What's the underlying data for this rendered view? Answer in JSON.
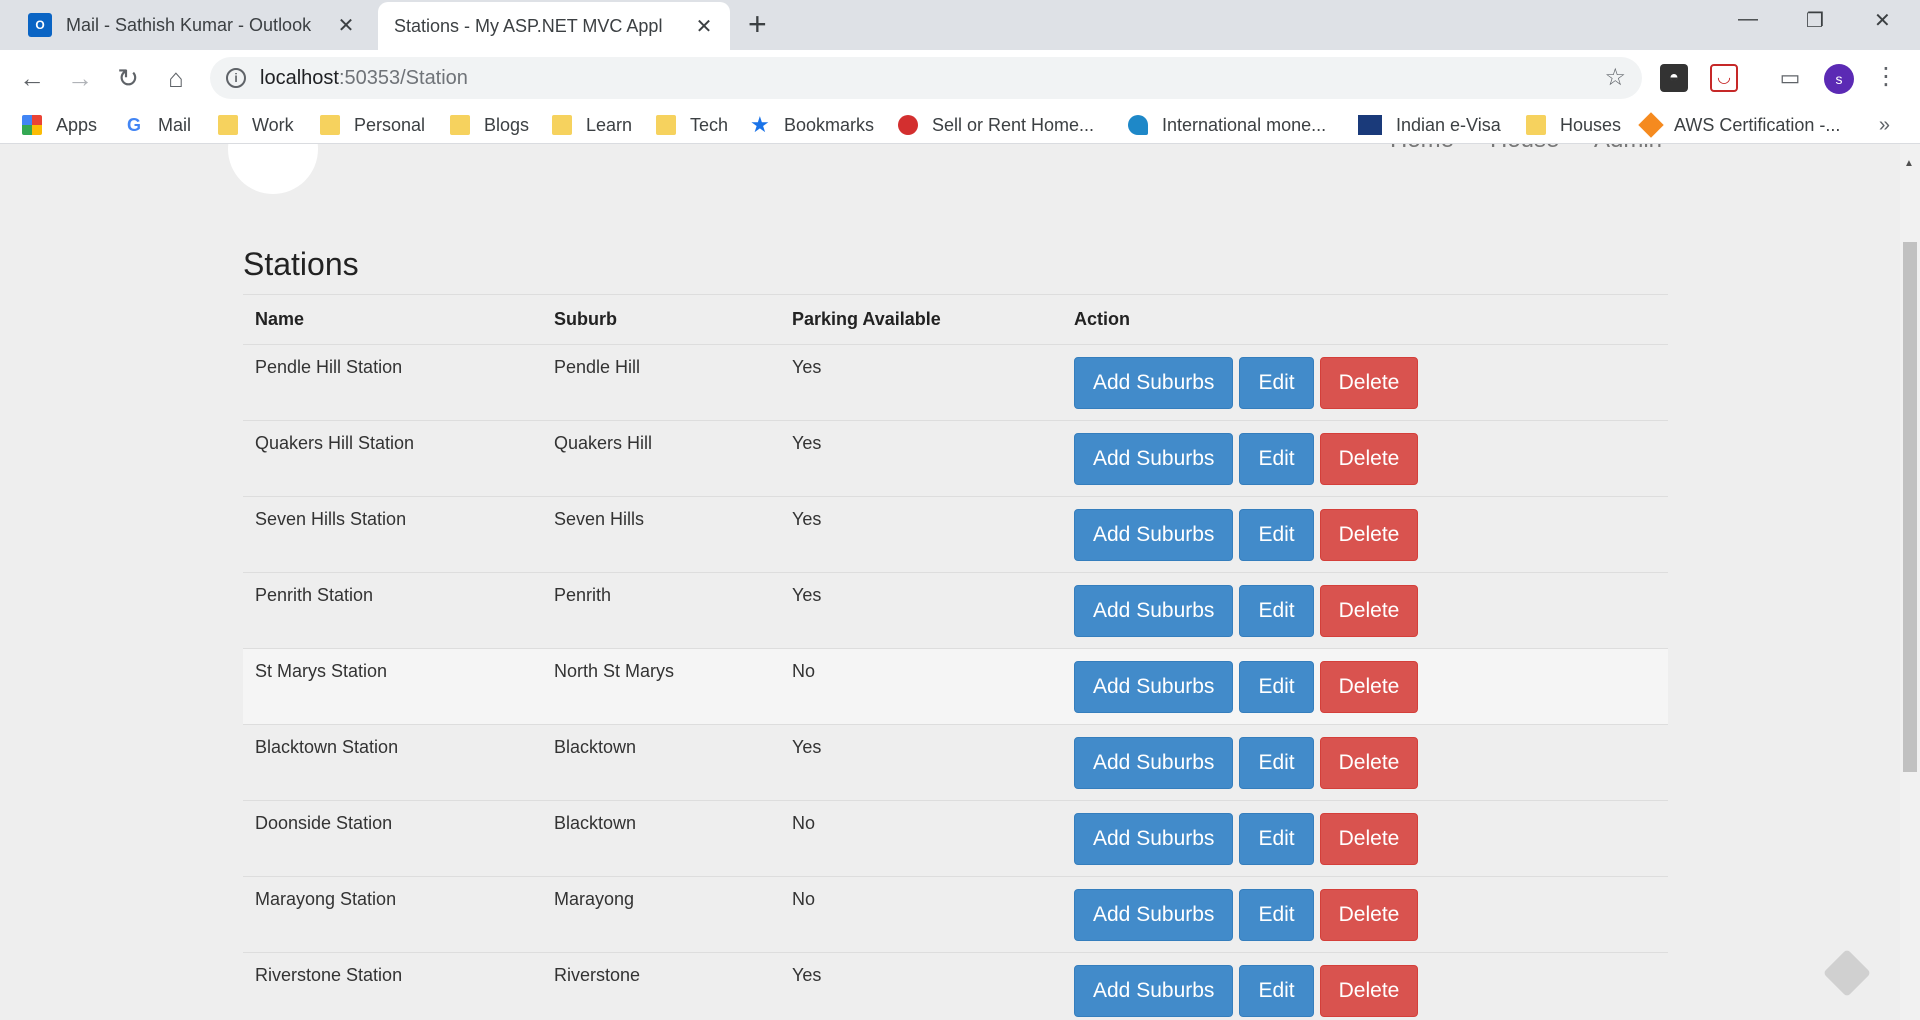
{
  "tabs": [
    {
      "title": "Mail - Sathish Kumar - Outlook",
      "close": "✕"
    },
    {
      "title": "Stations - My ASP.NET MVC Appl",
      "close": "✕"
    }
  ],
  "new_tab": "+",
  "window_controls": {
    "minimize": "—",
    "restore": "❐",
    "close": "✕"
  },
  "address_bar": {
    "host": "localhost",
    "rest": ":50353/Station"
  },
  "profile_initial": "s",
  "bookmarks": [
    {
      "label": "Apps",
      "icon": "apps-grid-icon"
    },
    {
      "label": "Mail",
      "icon": "google-icon"
    },
    {
      "label": "Work",
      "icon": "folder-icon"
    },
    {
      "label": "Personal",
      "icon": "folder-icon"
    },
    {
      "label": "Blogs",
      "icon": "folder-icon"
    },
    {
      "label": "Learn",
      "icon": "folder-icon"
    },
    {
      "label": "Tech",
      "icon": "folder-icon"
    },
    {
      "label": "Bookmarks",
      "icon": "star-icon"
    },
    {
      "label": "Sell or Rent Home...",
      "icon": "magicbricks-icon"
    },
    {
      "label": "International mone...",
      "icon": "transfer-icon"
    },
    {
      "label": "Indian e-Visa",
      "icon": "nic-icon"
    },
    {
      "label": "Houses",
      "icon": "folder-icon"
    },
    {
      "label": "AWS Certification -...",
      "icon": "aws-icon"
    }
  ],
  "bookmarks_more": "»",
  "site_nav": [
    "Home",
    "House",
    "Admin"
  ],
  "page_title": "Stations",
  "table": {
    "headers": {
      "name": "Name",
      "suburb": "Suburb",
      "parking": "Parking Available",
      "action": "Action"
    },
    "rows": [
      {
        "name": "Pendle Hill Station",
        "suburb": "Pendle Hill",
        "parking": "Yes"
      },
      {
        "name": "Quakers Hill Station",
        "suburb": "Quakers Hill",
        "parking": "Yes"
      },
      {
        "name": "Seven Hills Station",
        "suburb": "Seven Hills",
        "parking": "Yes"
      },
      {
        "name": "Penrith Station",
        "suburb": "Penrith",
        "parking": "Yes"
      },
      {
        "name": "St Marys Station",
        "suburb": "North St Marys",
        "parking": "No"
      },
      {
        "name": "Blacktown Station",
        "suburb": "Blacktown",
        "parking": "Yes"
      },
      {
        "name": "Doonside Station",
        "suburb": "Blacktown",
        "parking": "No"
      },
      {
        "name": "Marayong Station",
        "suburb": "Marayong",
        "parking": "No"
      },
      {
        "name": "Riverstone Station",
        "suburb": "Riverstone",
        "parking": "Yes"
      }
    ],
    "buttons": {
      "add": "Add Suburbs",
      "edit": "Edit",
      "delete": "Delete"
    }
  },
  "colors": {
    "primary": "#428bca",
    "danger": "#d9534f",
    "page_bg": "#eeeeee"
  }
}
